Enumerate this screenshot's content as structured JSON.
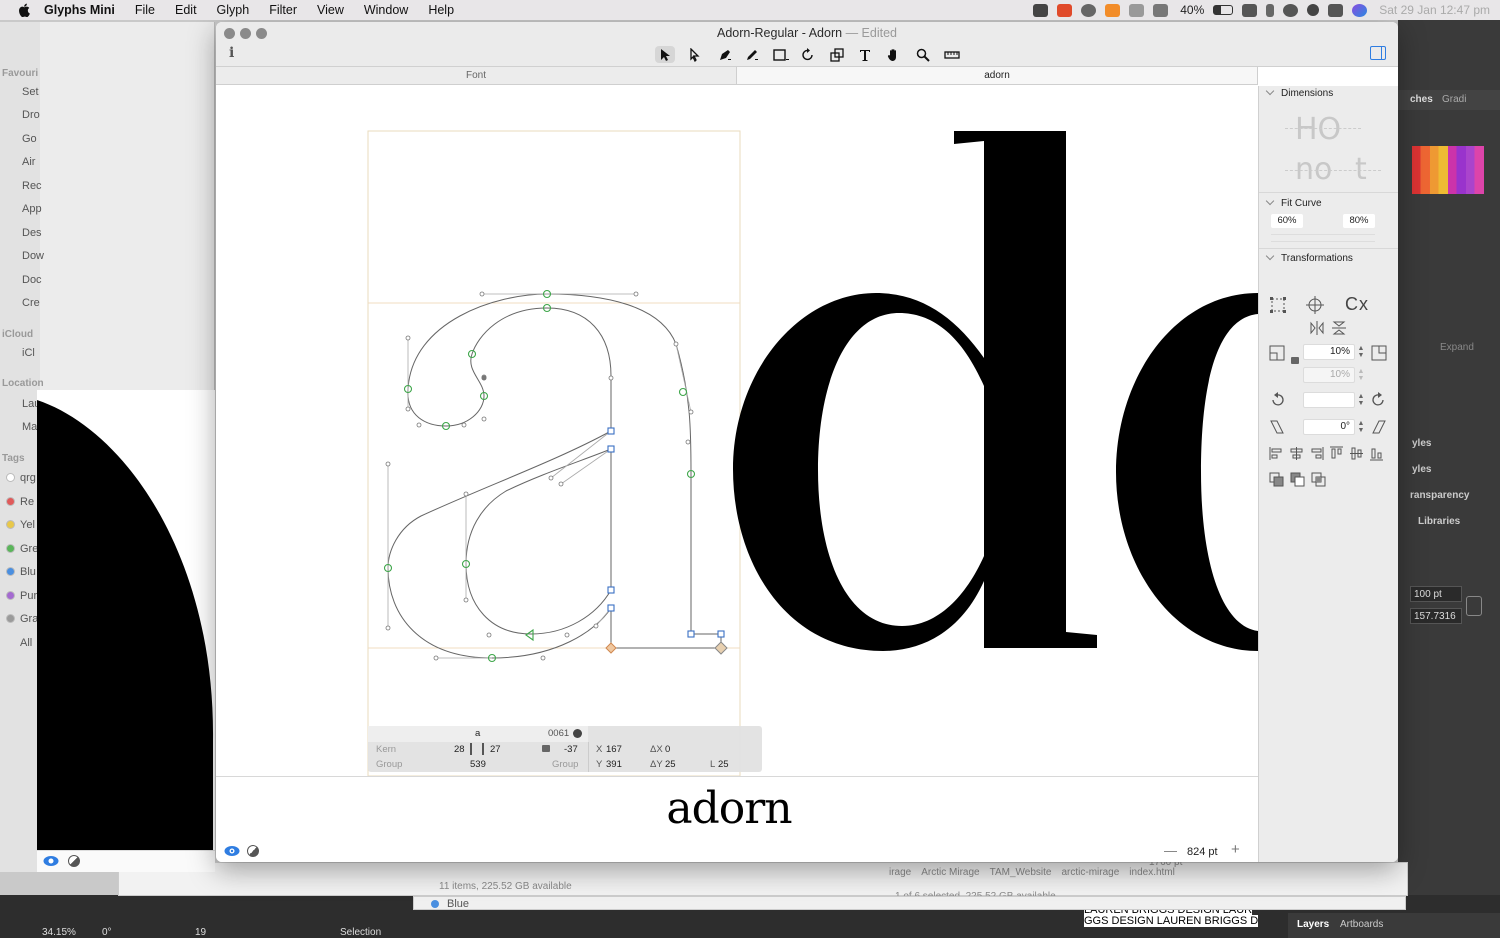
{
  "menubar": {
    "app": "Glyphs Mini",
    "items": [
      "File",
      "Edit",
      "Glyph",
      "Filter",
      "View",
      "Window",
      "Help"
    ],
    "battery": "40%",
    "datetime": "Sat 29 Jan  12:47 pm"
  },
  "window": {
    "title": "Adorn-Regular - Adorn",
    "edited": "— Edited"
  },
  "tabs": [
    {
      "label": "Font"
    },
    {
      "label": "adorn"
    }
  ],
  "canvas": {
    "glyph_name": "a",
    "unicode": "0061",
    "kern_label": "Kern",
    "kern_left": "28",
    "kern_right": "27",
    "kern_value": "-37",
    "group_label": "Group",
    "group_right_label": "Group",
    "width": "539",
    "x_label": "X",
    "x_value": "167",
    "y_label": "Y",
    "y_value": "391",
    "dx_label": "ΔX",
    "dx_value": "0",
    "dy_label": "ΔY",
    "dy_value": "25",
    "l_label": "L",
    "l_value": "25"
  },
  "preview": {
    "text": "adorn",
    "zoom": "824 pt"
  },
  "inspector": {
    "dimensions_label": "Dimensions",
    "dim_ho": "HO",
    "dim_no": "no",
    "dim_t": "t",
    "fit_curve_label": "Fit Curve",
    "fit_min": "60%",
    "fit_max": "80%",
    "transformations_label": "Transformations",
    "cx_label": "Cx",
    "scale_x": "10%",
    "scale_y": "10%",
    "rotate": "",
    "slant": "0°"
  },
  "background": {
    "finder_sidebar": {
      "favourites_header": "Favouri",
      "icloud_header": "iCloud",
      "locations_header": "Location",
      "tags_header": "Tags",
      "items": [
        "Set",
        "Dro",
        "Go",
        "Air",
        "Rec",
        "App",
        "Des",
        "Dow",
        "Doc",
        "Cre"
      ],
      "icloud": [
        "iCl"
      ],
      "locations": [
        "Lau",
        "Ma"
      ],
      "tags": [
        {
          "label": "qrg",
          "color": "#ffffff"
        },
        {
          "label": "Re",
          "color": "#e05a5a"
        },
        {
          "label": "Yel",
          "color": "#e8c84a"
        },
        {
          "label": "Gre",
          "color": "#5ab55a"
        },
        {
          "label": "Blu",
          "color": "#4a8fe0"
        },
        {
          "label": "Pur",
          "color": "#a46ad0"
        },
        {
          "label": "Gra",
          "color": "#9a9a9a"
        },
        {
          "label": "All",
          "color": ""
        }
      ]
    },
    "finder_status_1": "11 items, 225.52 GB available",
    "finder_status_2": "1 of 6 selected, 225.52 GB available",
    "finder_path": [
      "irage",
      "Arctic Mirage",
      "TAM_Website",
      "arctic-mirage",
      "index.html"
    ],
    "finder_tag_blue": "Blue",
    "ai_width": "1760 pt",
    "illustrator": {
      "tab_swatches": "ches",
      "tab_gradient": "Gradi",
      "expand": "Expand",
      "styles_1": "yles",
      "styles_2": "yles",
      "transparency": "ransparency",
      "libraries": "Libraries",
      "stroke_value": "100 pt",
      "stroke_value_2": "157.7316",
      "zoom": "34.15%",
      "angle": "0°",
      "artboard": "19",
      "mode": "Selection",
      "layers": "Layers",
      "artboards": "Artboards",
      "credit_1": "LAUREN BRIGGS DESIGN LAUR",
      "credit_2": "GGS DESIGN LAUREN BRIGGS D"
    }
  },
  "colors": {
    "accent": "#2f7de1",
    "node_green": "#3ea64a",
    "node_blue": "#3a6fc4",
    "metric_line": "#f0dcc0",
    "outline": "#666666"
  }
}
